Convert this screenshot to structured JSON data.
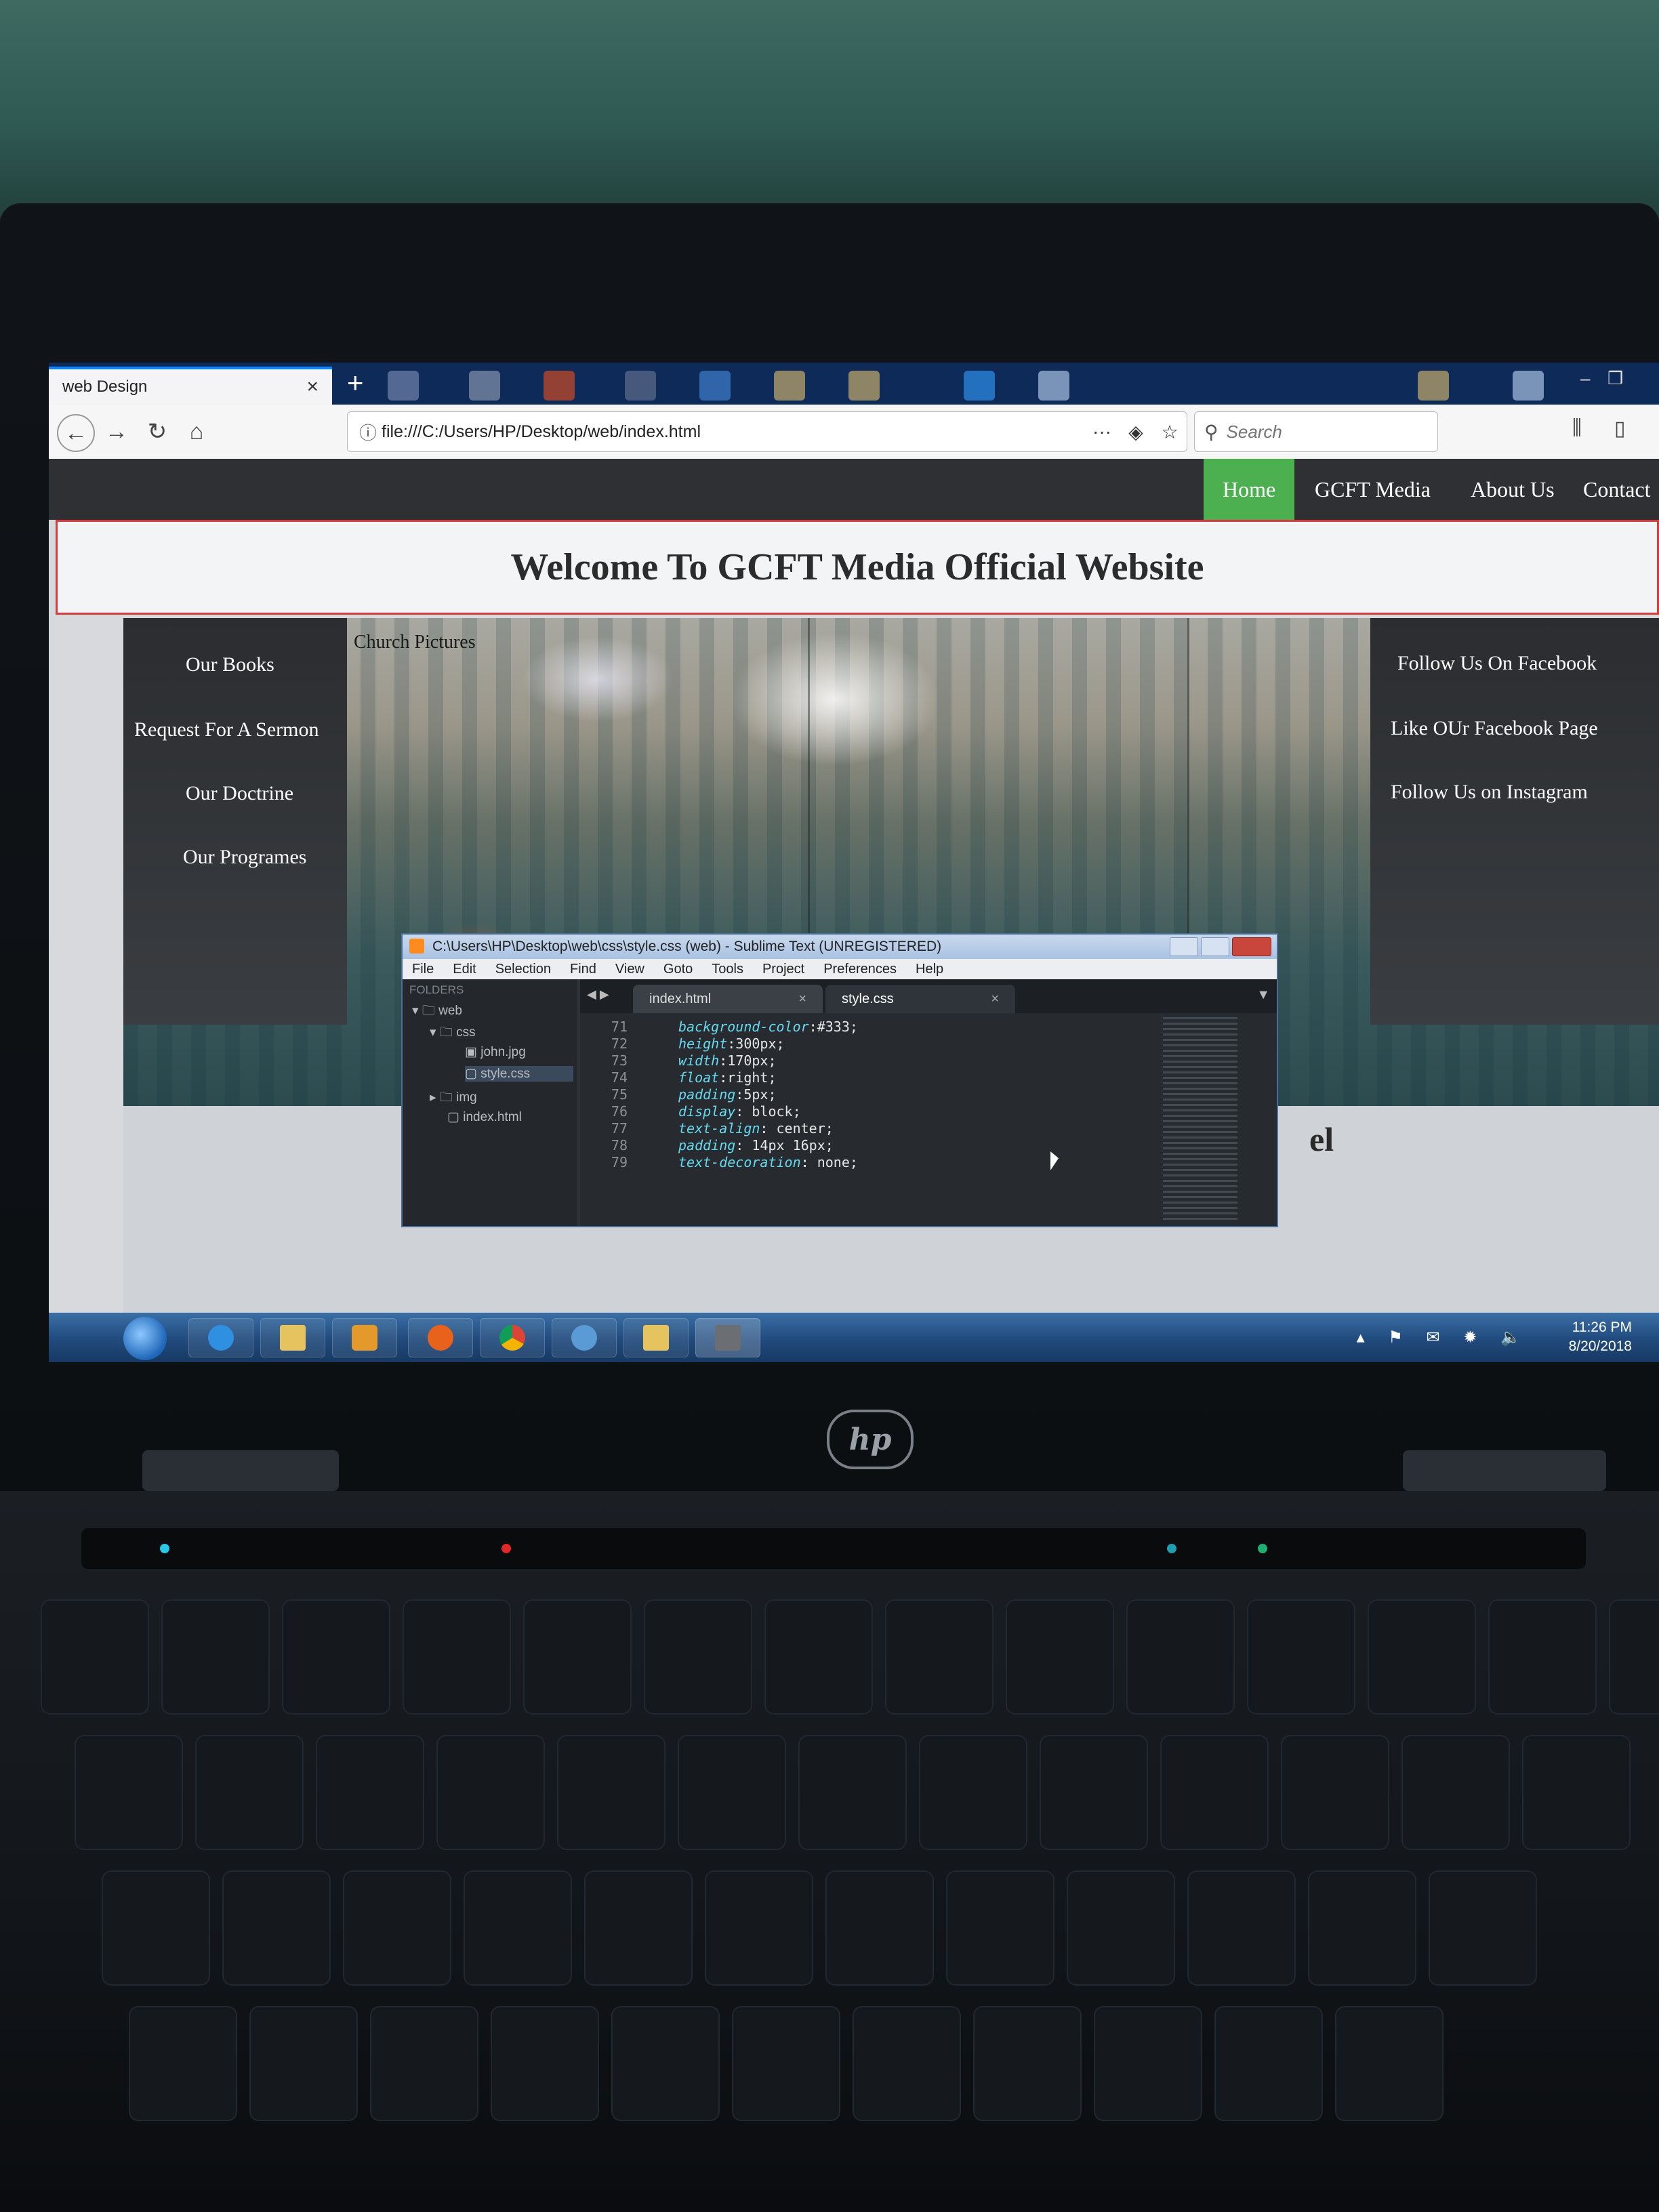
{
  "browser": {
    "tab_title": "web Design",
    "url": "file:///C:/Users/HP/Desktop/web/index.html",
    "search_placeholder": "Search"
  },
  "site": {
    "nav": [
      "Home",
      "GCFT Media",
      "About Us",
      "Contact"
    ],
    "active_nav": "Home",
    "heading": "Welcome To GCFT Media Official Website",
    "photo_caption": "Church Pictures",
    "left_links": [
      "Our Books",
      "Request For A Sermon",
      "Our Doctrine",
      "Our Programes"
    ],
    "right_links": [
      "Follow Us On Facebook",
      "Like OUr Facebook Page",
      "Follow Us on Instagram"
    ],
    "lower_fragment": "el",
    "colors": {
      "nav_bg": "#2e3033",
      "active_nav": "#4caf50",
      "header_border": "#d23d3d"
    }
  },
  "editor": {
    "title": "C:\\Users\\HP\\Desktop\\web\\css\\style.css (web) - Sublime Text (UNREGISTERED)",
    "menu": [
      "File",
      "Edit",
      "Selection",
      "Find",
      "View",
      "Goto",
      "Tools",
      "Project",
      "Preferences",
      "Help"
    ],
    "sidebar_header": "FOLDERS",
    "tree": [
      "web",
      "css",
      "john.jpg",
      "style.css",
      "img",
      "index.html"
    ],
    "tabs": [
      "index.html",
      "style.css"
    ],
    "active_tab": "style.css",
    "lines": [
      {
        "n": "71",
        "code": "background-color:#333;"
      },
      {
        "n": "72",
        "code": "height:300px;"
      },
      {
        "n": "73",
        "code": "width:170px;"
      },
      {
        "n": "74",
        "code": "float:right;"
      },
      {
        "n": "75",
        "code": "padding:5px;"
      },
      {
        "n": "76",
        "code": "display: block;"
      },
      {
        "n": "77",
        "code": "text-align: center;"
      },
      {
        "n": "78",
        "code": "padding: 14px 16px;"
      },
      {
        "n": "79",
        "code": "text-decoration: none;"
      }
    ]
  },
  "taskbar": {
    "time": "11:26 PM",
    "date": "8/20/2018"
  }
}
